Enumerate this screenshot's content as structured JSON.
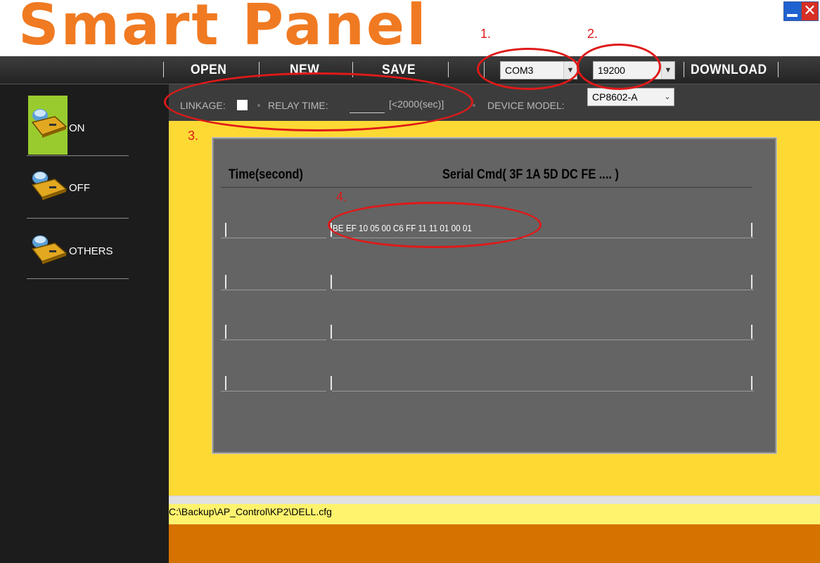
{
  "app": {
    "title": "Smart Panel"
  },
  "menu": {
    "open": "OPEN",
    "new": "NEW",
    "save": "SAVE",
    "com_port": "COM3",
    "baud_rate": "19200",
    "download": "DOWNLOAD"
  },
  "sidebar": {
    "items": [
      {
        "label": "ON",
        "icon": "device-on-icon"
      },
      {
        "label": "OFF",
        "icon": "device-off-icon"
      },
      {
        "label": "OTHERS",
        "icon": "device-others-icon"
      }
    ]
  },
  "config": {
    "linkage_label": "LINKAGE:",
    "relay_time_label": "RELAY TIME:",
    "relay_time_value": "",
    "relay_time_hint": "[<2000(sec)]",
    "device_model_label": "DEVICE MODEL:",
    "device_model": "CP8602-A"
  },
  "table": {
    "headers": {
      "time": "Time(second)",
      "cmd": "Serial Cmd( 3F  1A  5D  DC  FE .... )"
    },
    "rows": [
      {
        "time": "",
        "cmd": "BE EF 10 05 00 C6 FF 11 11 01 00 01"
      },
      {
        "time": "",
        "cmd": ""
      },
      {
        "time": "",
        "cmd": ""
      },
      {
        "time": "",
        "cmd": ""
      }
    ]
  },
  "annotations": {
    "a1": "1.",
    "a2": "2.",
    "a3": "3.",
    "a4": "4."
  },
  "status": {
    "path": "C:\\Backup\\AP_Control\\KP2\\DELL.cfg"
  },
  "colors": {
    "title": "#f07a22",
    "main_bg": "#fdd934",
    "panel_bg": "#646464",
    "sidebar_bg": "#1c1c1c",
    "highlight": "#9acb2e",
    "annotation": "#e01919",
    "bottom_bar": "#d67200"
  }
}
